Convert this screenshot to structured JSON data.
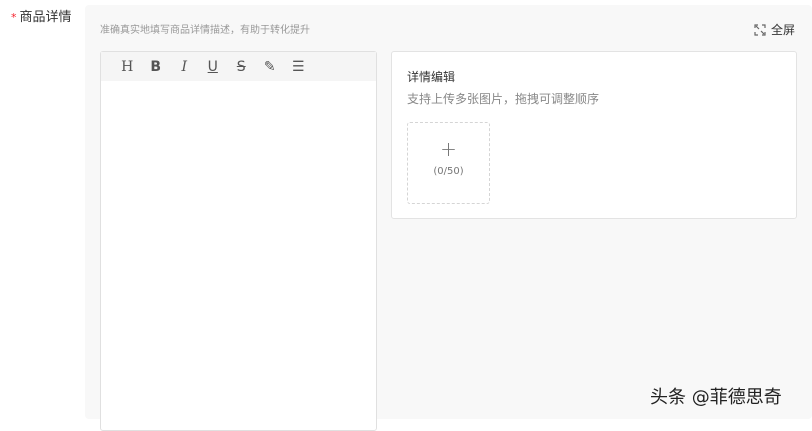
{
  "field": {
    "required_mark": "*",
    "label": "商品详情"
  },
  "hint": "准确真实地填写商品详情描述，有助于转化提升",
  "fullscreen": {
    "label": "全屏",
    "icon": "expand-icon"
  },
  "toolbar": [
    {
      "name": "heading",
      "glyph": "H"
    },
    {
      "name": "bold",
      "glyph": "B"
    },
    {
      "name": "italic",
      "glyph": "I"
    },
    {
      "name": "underline",
      "glyph": "U"
    },
    {
      "name": "strikethrough",
      "glyph": "S"
    },
    {
      "name": "highlight",
      "glyph": "✎"
    },
    {
      "name": "align",
      "glyph": "☰"
    }
  ],
  "card": {
    "title": "详情编辑",
    "subtitle": "支持上传多张图片，拖拽可调整顺序",
    "upload_plus": "+",
    "upload_count": "(0/50)"
  },
  "watermark": "头条 @菲德思奇"
}
